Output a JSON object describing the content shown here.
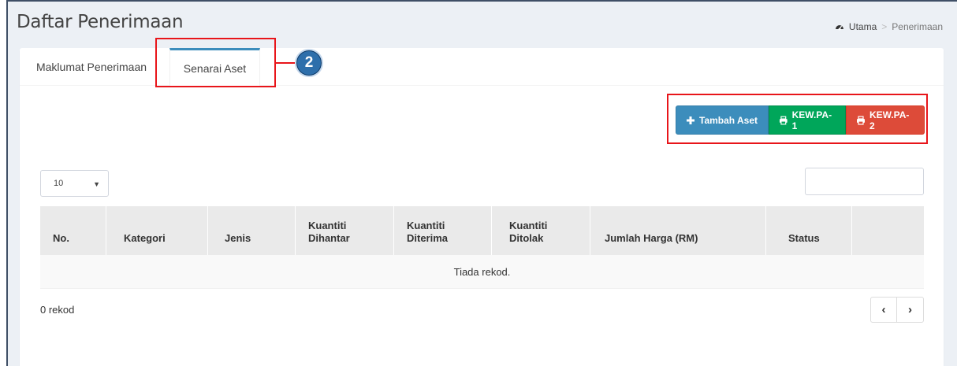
{
  "header": {
    "title": "Daftar Penerimaan",
    "breadcrumb": {
      "home": "Utama",
      "separator": ">",
      "current": "Penerimaan"
    }
  },
  "tabs": [
    {
      "label": "Maklumat Penerimaan",
      "active": false
    },
    {
      "label": "Senarai Aset",
      "active": true
    }
  ],
  "annotation": {
    "step": "2",
    "highlight_color": "#e8151a"
  },
  "actions": {
    "add_label": "Tambah Aset",
    "print1_label": "KEW.PA-1",
    "print2_label": "KEW.PA-2"
  },
  "table": {
    "page_length": "10",
    "search_value": "",
    "columns": [
      "No.",
      "Kategori",
      "Jenis",
      "Kuantiti Dihantar",
      "Kuantiti Diterima",
      "Kuantiti Ditolak",
      "Jumlah Harga (RM)",
      "Status",
      ""
    ],
    "empty_message": "Tiada rekod.",
    "info": "0 rekod"
  },
  "colors": {
    "primary": "#3c8dbc",
    "success": "#00a65a",
    "danger": "#dd4b39"
  }
}
